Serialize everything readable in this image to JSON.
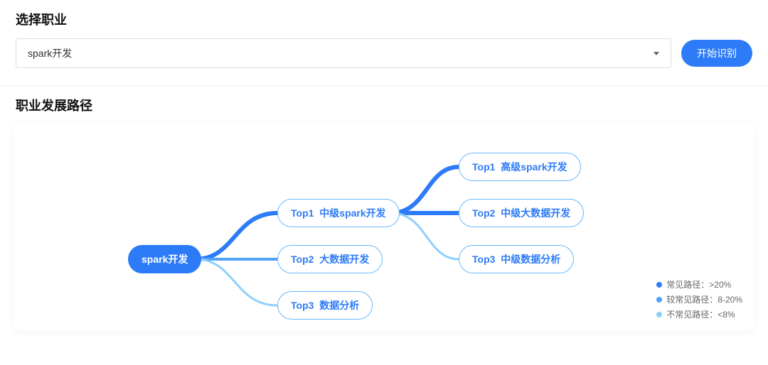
{
  "select": {
    "title": "选择职业",
    "value": "spark开发",
    "button": "开始识别"
  },
  "path": {
    "title": "职业发展路径"
  },
  "diagram": {
    "root": {
      "label": "spark开发"
    },
    "level1": [
      {
        "rank": "Top1",
        "label": "中级spark开发"
      },
      {
        "rank": "Top2",
        "label": "大数据开发"
      },
      {
        "rank": "Top3",
        "label": "数据分析"
      }
    ],
    "level2": [
      {
        "rank": "Top1",
        "label": "高级spark开发"
      },
      {
        "rank": "Top2",
        "label": "中级大数据开发"
      },
      {
        "rank": "Top3",
        "label": "中级数据分析"
      }
    ]
  },
  "legend": {
    "items": [
      {
        "color": "#2d7bf7",
        "text": "常见路径：>20%"
      },
      {
        "color": "#4fa3f7",
        "text": "较常见路径：8-20%"
      },
      {
        "color": "#8fd0fb",
        "text": "不常见路径：<8%"
      }
    ]
  }
}
